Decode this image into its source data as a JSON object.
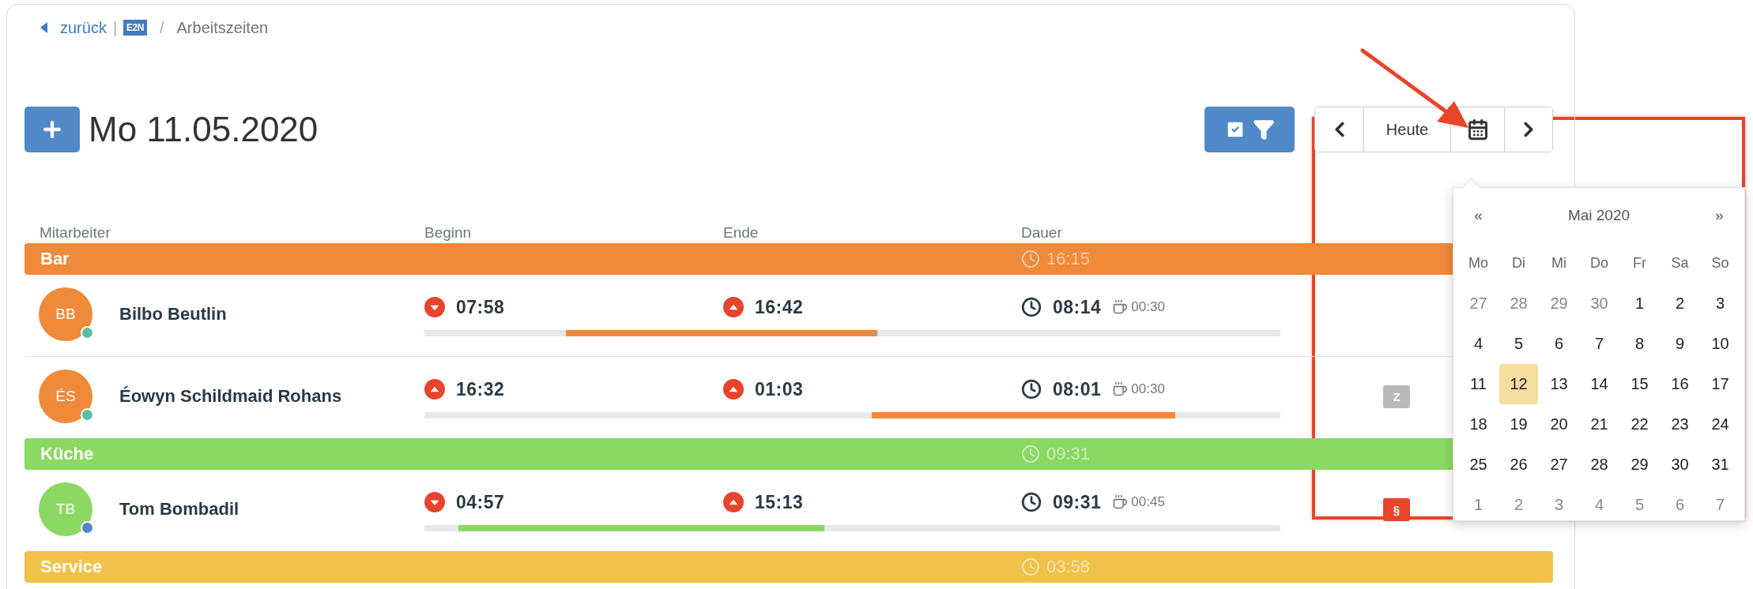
{
  "breadcrumb": {
    "back": "zurück",
    "separator": "|",
    "logo": "E2N",
    "divider": "/",
    "current": "Arbeitszeiten"
  },
  "title": "Mo 11.05.2020",
  "toolbar": {
    "today": "Heute"
  },
  "columns": [
    "Mitarbeiter",
    "Beginn",
    "Ende",
    "Dauer"
  ],
  "groups": [
    {
      "name": "Bar",
      "color": "#ee8a3a",
      "total": "16:15",
      "employees": [
        {
          "initials": "BB",
          "name": "Bilbo Beutlin",
          "color": "#5bbf9f",
          "begin": "07:58",
          "begin_arrow_up": false,
          "end": "16:42",
          "end_arrow_up": true,
          "duration": "08:14",
          "break": "00:30"
        },
        {
          "initials": "ÉS",
          "name": "Éowyn Schildmaid Rohans",
          "color": "#5bbf9f",
          "begin": "16:32",
          "begin_arrow_up": true,
          "end": "01:03",
          "end_arrow_up": true,
          "duration": "08:01",
          "break": "00:30",
          "badge": {
            "text": "Z",
            "kind": "neutral"
          }
        }
      ]
    },
    {
      "name": "Küche",
      "color": "#8bd862",
      "total": "09:31",
      "employees": [
        {
          "initials": "TB",
          "name": "Tom Bombadil",
          "color": "#4f86c6",
          "begin": "04:57",
          "begin_arrow_up": false,
          "end": "15:13",
          "end_arrow_up": true,
          "duration": "09:31",
          "break": "00:45",
          "badge": {
            "text": "§",
            "kind": "alert"
          }
        }
      ]
    },
    {
      "name": "Service",
      "color": "#f0c24a",
      "total": "03:58"
    }
  ],
  "calendar": {
    "prev": "«",
    "month": "Mai 2020",
    "next": "»",
    "weekdays": [
      "Mo",
      "Di",
      "Mi",
      "Do",
      "Fr",
      "Sa",
      "So"
    ],
    "weeks": [
      [
        {
          "day": "27",
          "muted": true,
          "selected": false
        },
        {
          "day": "28",
          "muted": true,
          "selected": false
        },
        {
          "day": "29",
          "muted": true,
          "selected": false
        },
        {
          "day": "30",
          "muted": true,
          "selected": false
        },
        {
          "day": "1",
          "muted": false,
          "selected": false
        },
        {
          "day": "2",
          "muted": false,
          "selected": false
        },
        {
          "day": "3",
          "muted": false,
          "selected": false
        }
      ],
      [
        {
          "day": "4",
          "muted": false,
          "selected": false
        },
        {
          "day": "5",
          "muted": false,
          "selected": false
        },
        {
          "day": "6",
          "muted": false,
          "selected": false
        },
        {
          "day": "7",
          "muted": false,
          "selected": false
        },
        {
          "day": "8",
          "muted": false,
          "selected": false
        },
        {
          "day": "9",
          "muted": false,
          "selected": false
        },
        {
          "day": "10",
          "muted": false,
          "selected": false
        }
      ],
      [
        {
          "day": "11",
          "muted": false,
          "selected": false
        },
        {
          "day": "12",
          "muted": false,
          "selected": true
        },
        {
          "day": "13",
          "muted": false,
          "selected": false
        },
        {
          "day": "14",
          "muted": false,
          "selected": false
        },
        {
          "day": "15",
          "muted": false,
          "selected": false
        },
        {
          "day": "16",
          "muted": false,
          "selected": false
        },
        {
          "day": "17",
          "muted": false,
          "selected": false
        }
      ],
      [
        {
          "day": "18",
          "muted": false,
          "selected": false
        },
        {
          "day": "19",
          "muted": false,
          "selected": false
        },
        {
          "day": "20",
          "muted": false,
          "selected": false
        },
        {
          "day": "21",
          "muted": false,
          "selected": false
        },
        {
          "day": "22",
          "muted": false,
          "selected": false
        },
        {
          "day": "23",
          "muted": false,
          "selected": false
        },
        {
          "day": "24",
          "muted": false,
          "selected": false
        }
      ],
      [
        {
          "day": "25",
          "muted": false,
          "selected": false
        },
        {
          "day": "26",
          "muted": false,
          "selected": false
        },
        {
          "day": "27",
          "muted": false,
          "selected": false
        },
        {
          "day": "28",
          "muted": false,
          "selected": false
        },
        {
          "day": "29",
          "muted": false,
          "selected": false
        },
        {
          "day": "30",
          "muted": false,
          "selected": false
        },
        {
          "day": "31",
          "muted": false,
          "selected": false
        }
      ],
      [
        {
          "day": "1",
          "muted": true,
          "selected": false
        },
        {
          "day": "2",
          "muted": true,
          "selected": false
        },
        {
          "day": "3",
          "muted": true,
          "selected": false
        },
        {
          "day": "4",
          "muted": true,
          "selected": false
        },
        {
          "day": "5",
          "muted": true,
          "selected": false
        },
        {
          "day": "6",
          "muted": true,
          "selected": false
        },
        {
          "day": "7",
          "muted": true,
          "selected": false
        }
      ]
    ]
  }
}
